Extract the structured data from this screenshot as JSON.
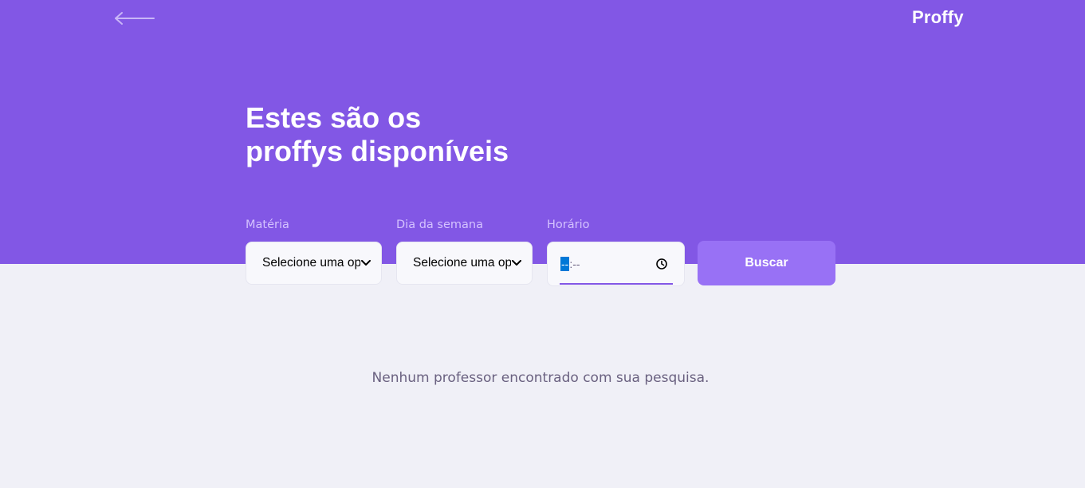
{
  "header": {
    "back_icon": "arrow-left-icon",
    "logo_text": "Proffy"
  },
  "hero": {
    "title_line1": "Estes são os",
    "title_line2": "proffys disponíveis"
  },
  "filters": {
    "subject": {
      "label": "Matéria",
      "selected": "Selecione uma opção"
    },
    "weekday": {
      "label": "Dia da semana",
      "selected": "Selecione uma opção"
    },
    "time": {
      "label": "Horário",
      "hours": "--",
      "separator": ":",
      "minutes": "--",
      "icon": "clock-icon"
    },
    "search_button": "Buscar"
  },
  "results": {
    "empty_message": "Nenhum professor encontrado com sua pesquisa."
  },
  "colors": {
    "primary": "#8257E5",
    "primary_lighter": "#9871F5",
    "background": "#F0F0F7",
    "label": "#D4C2FF",
    "text_muted": "#6A6180",
    "input_bg": "#F8F8FC"
  }
}
